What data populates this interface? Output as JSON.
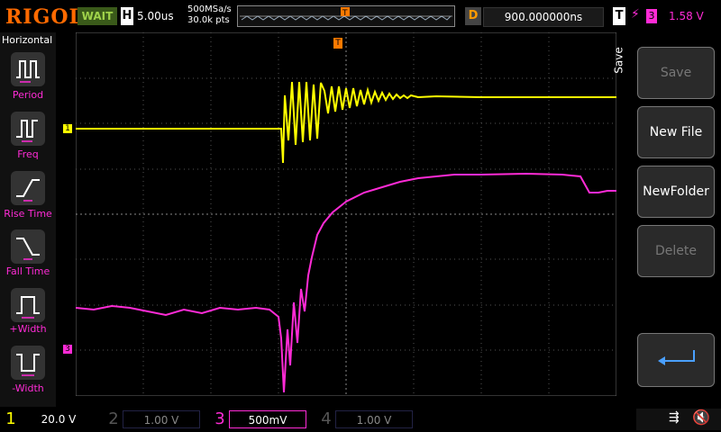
{
  "header": {
    "logo": "RIGOL",
    "status": "WAIT",
    "horizontal_key": "H",
    "timebase": "5.00us",
    "sample_rate": "500MSa/s",
    "points": "30.0k pts",
    "delay_key": "D",
    "delay_value": "900.000000ns",
    "trigger_key": "T",
    "trigger_source": "3",
    "trigger_level": "1.58 V"
  },
  "left_menu": {
    "title": "Horizontal",
    "items": [
      {
        "label": "Period"
      },
      {
        "label": "Freq"
      },
      {
        "label": "Rise Time"
      },
      {
        "label": "Fall Time"
      },
      {
        "label": "+Width"
      },
      {
        "label": "-Width"
      }
    ]
  },
  "right_menu": {
    "tab": "Save",
    "softkeys": [
      "Save",
      "New File",
      "NewFolder",
      "Delete"
    ]
  },
  "channels": [
    {
      "number": "1",
      "value": "20.0 V",
      "color": "#ffff00",
      "active": true
    },
    {
      "number": "2",
      "value": "1.00 V",
      "color": "#00c0c0",
      "active": false
    },
    {
      "number": "3",
      "value": "500mV",
      "color": "#ff2bd6",
      "active": true
    },
    {
      "number": "4",
      "value": "1.00 V",
      "color": "#2060ff",
      "active": false
    }
  ],
  "markers": {
    "ch1": "1",
    "ch3": "3",
    "trigger_pos": "T",
    "trigger_level": "T"
  }
}
